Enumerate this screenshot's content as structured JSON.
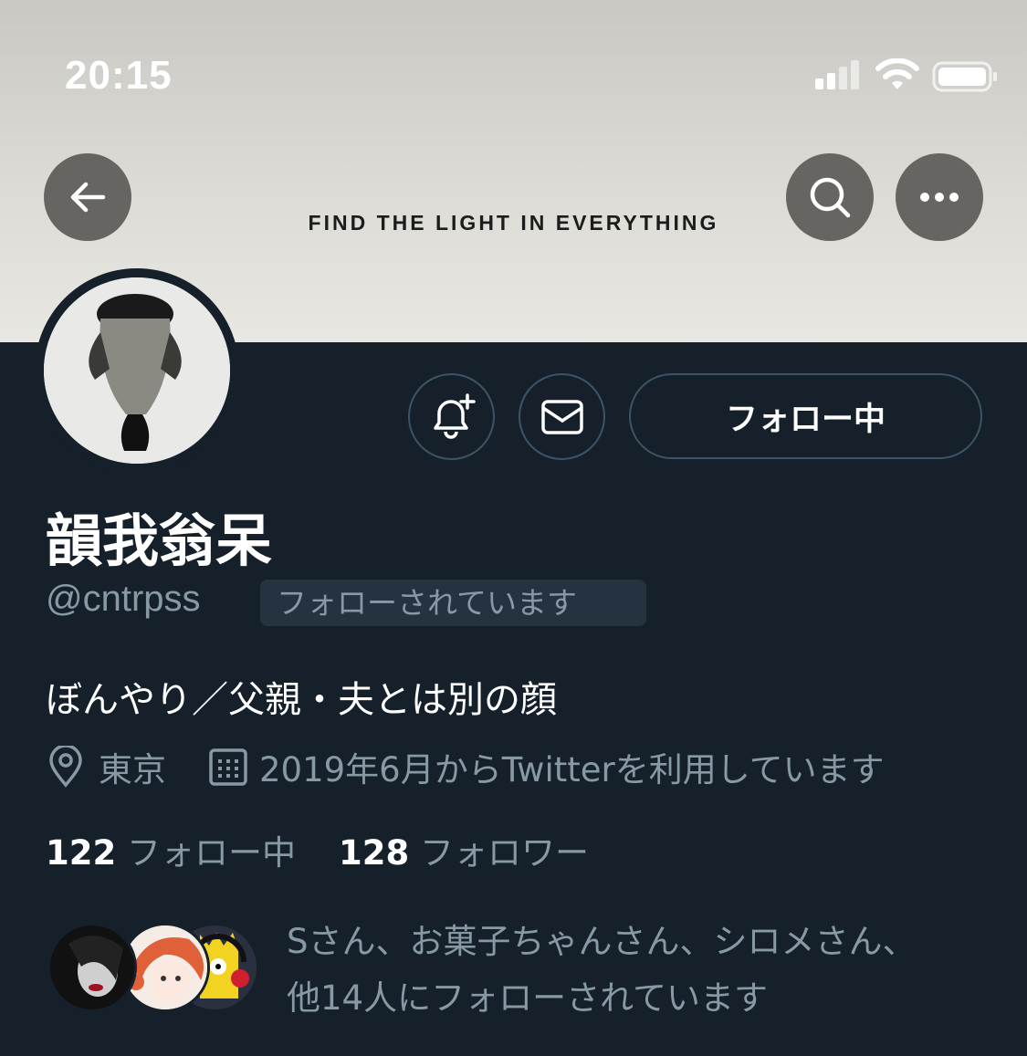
{
  "status_bar": {
    "time": "20:15"
  },
  "banner": {
    "text": "FIND THE LIGHT IN EVERYTHING"
  },
  "profile": {
    "display_name": "韻我翁呆",
    "handle": "@cntrpss",
    "follows_you_badge": "フォローされています",
    "bio": "ぼんやり／父親・夫とは別の顔",
    "location": "東京",
    "joined": "2019年6月からTwitterを利用しています",
    "following_count": "122",
    "following_label": "フォロー中",
    "followers_count": "128",
    "followers_label": "フォロワー",
    "followed_by_line1": "Sさん、お菓子ちゃんさん、シロメさん、",
    "followed_by_line2": "他14人にフォローされています"
  },
  "actions": {
    "follow_button_label": "フォロー中"
  },
  "icons": [
    "back-arrow-icon",
    "search-icon",
    "more-icon",
    "notification-add-icon",
    "mail-icon",
    "location-icon",
    "calendar-icon"
  ],
  "colors": {
    "background": "#15202b",
    "secondary_text": "#8899a6",
    "button_border": "#3d5466"
  }
}
